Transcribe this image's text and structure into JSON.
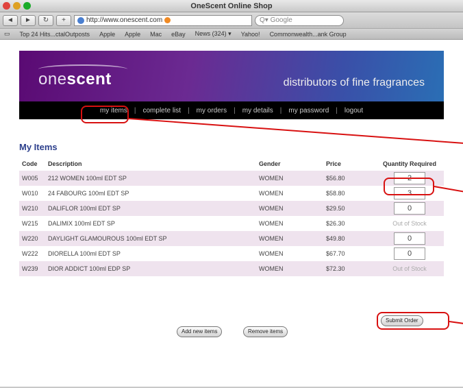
{
  "window": {
    "title": "OneScent Online Shop"
  },
  "toolbar": {
    "back": "◄",
    "fwd": "►",
    "reload": "↻",
    "add": "+",
    "url": "http://www.onescent.com",
    "search_placeholder": "Google"
  },
  "bookmarks": [
    "Top 24 Hits...ctalOutposts",
    "Apple",
    "Apple",
    "Mac",
    "eBay",
    "News (324) ▾",
    "Yahoo!",
    "Commonwealth...ank Group"
  ],
  "banner": {
    "logo_one": "one",
    "logo_scent": "scent",
    "tagline": "distributors of fine fragrances"
  },
  "nav": {
    "items": [
      "my items",
      "complete list",
      "my orders",
      "my details",
      "my password",
      "logout"
    ]
  },
  "heading": "My Items",
  "table": {
    "headers": [
      "Code",
      "Description",
      "Gender",
      "Price",
      "Quantity Required"
    ],
    "rows": [
      {
        "code": "W005",
        "description": "212 WOMEN 100ml EDT SP",
        "gender": "WOMEN",
        "price": "$56.80",
        "qty": "2"
      },
      {
        "code": "W010",
        "description": "24 FABOURG 100ml EDT SP",
        "gender": "WOMEN",
        "price": "$58.80",
        "qty": "3"
      },
      {
        "code": "W210",
        "description": "DALIFLOR 100ml EDT SP",
        "gender": "WOMEN",
        "price": "$29.50",
        "qty": "0"
      },
      {
        "code": "W215",
        "description": "DALIMIX 100ml EDT SP",
        "gender": "WOMEN",
        "price": "$26.30",
        "qty": "Out of Stock"
      },
      {
        "code": "W220",
        "description": "DAYLIGHT GLAMOUROUS 100ml EDT SP",
        "gender": "WOMEN",
        "price": "$49.80",
        "qty": "0"
      },
      {
        "code": "W222",
        "description": "DIORELLA 100ml EDT SP",
        "gender": "WOMEN",
        "price": "$67.70",
        "qty": "0"
      },
      {
        "code": "W239",
        "description": "DIOR ADDICT 100ml EDP SP",
        "gender": "WOMEN",
        "price": "$72.30",
        "qty": "Out of Stock"
      }
    ]
  },
  "buttons": {
    "submit": "Submit Order",
    "add_items": "Add new items",
    "remove_items": "Remove items"
  },
  "colors": {
    "accent": "#2c3f8c",
    "callout": "#d81010",
    "row_tint": "#efe3ee"
  }
}
